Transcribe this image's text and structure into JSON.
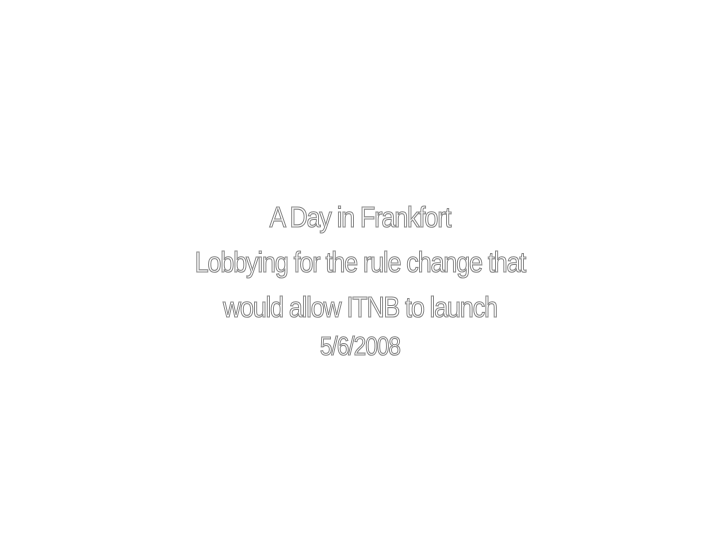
{
  "slide": {
    "title": "A Day in Frankfort",
    "subtitle_line1": "Lobbying for the rule change that",
    "subtitle_line2": "would allow ITNB to launch",
    "date": "5/6/2008"
  },
  "colors": {
    "background": "#ffffff",
    "text_fill": "#ffffff",
    "text_outline": "#8a8a8a"
  }
}
